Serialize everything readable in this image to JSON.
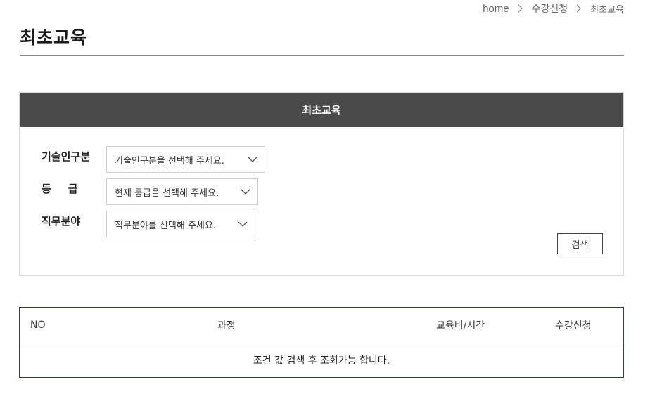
{
  "breadcrumb": {
    "home": "home",
    "level1": "수강신청",
    "current": "최초교육"
  },
  "page": {
    "title": "최초교육"
  },
  "search": {
    "header": "최초교육",
    "fields": [
      {
        "label": "기술인구분",
        "value": "기술인구분을 선택해 주세요."
      },
      {
        "label": "등급",
        "value": "현재 등급을 선택해 주세요."
      },
      {
        "label": "직무분야",
        "value": "직무분야를 선택해 주세요."
      }
    ],
    "button_label": "검색"
  },
  "table": {
    "columns": [
      "NO",
      "과정",
      "교육비/시간",
      "수강신청"
    ],
    "empty_message": "조건 값 검색 후 조회가능 합니다."
  },
  "icons": {
    "separator": "chevron-right-icon",
    "dropdown": "chevron-down-icon"
  }
}
